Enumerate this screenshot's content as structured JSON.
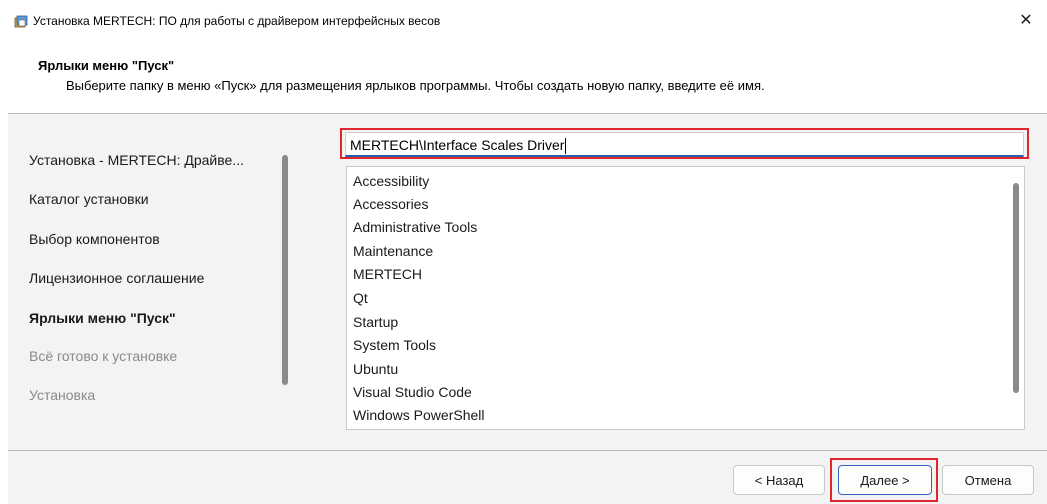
{
  "window": {
    "title": "Установка MERTECH: ПО для работы с драйвером интерфейсных весов",
    "close_glyph": "✕"
  },
  "header": {
    "title": "Ярлыки меню \"Пуск\"",
    "subtitle": "Выберите папку в меню «Пуск» для размещения ярлыков программы. Чтобы создать новую папку, введите её имя."
  },
  "sidebar": {
    "items": [
      {
        "label": "Установка - MERTECH: Драйве...",
        "state": "normal"
      },
      {
        "label": "Каталог установки",
        "state": "normal"
      },
      {
        "label": "Выбор компонентов",
        "state": "normal"
      },
      {
        "label": "Лицензионное соглашение",
        "state": "normal"
      },
      {
        "label": "Ярлыки меню \"Пуск\"",
        "state": "active"
      },
      {
        "label": "Всё готово к установке",
        "state": "disabled"
      },
      {
        "label": "Установка",
        "state": "disabled"
      }
    ]
  },
  "folder_input": {
    "value": "MERTECH\\Interface Scales Driver"
  },
  "folder_list": {
    "items": [
      "Accessibility",
      "Accessories",
      "Administrative Tools",
      "Maintenance",
      "MERTECH",
      "Qt",
      "Startup",
      "System Tools",
      "Ubuntu",
      "Visual Studio Code",
      "Windows PowerShell"
    ]
  },
  "footer": {
    "back_label": "< Назад",
    "next_label": "Далее >",
    "cancel_label": "Отмена"
  },
  "colors": {
    "highlight": "#e0262c",
    "focus": "#2a5caa"
  }
}
